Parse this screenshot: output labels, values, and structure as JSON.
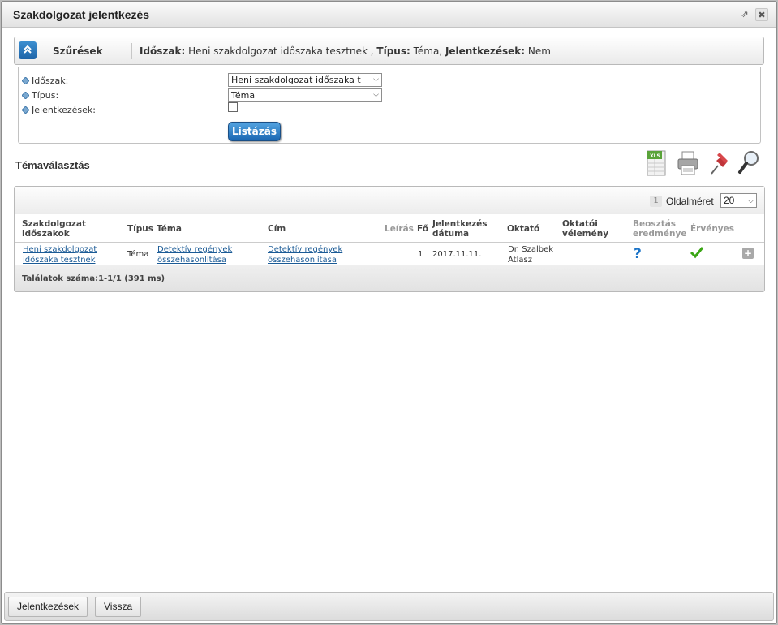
{
  "window": {
    "title": "Szakdolgozat jelentkezés",
    "popout_icon": "external-link-icon",
    "close_icon": "close-icon",
    "close_glyph": "✖",
    "popout_glyph": "⇗"
  },
  "filter": {
    "label": "Szűrések",
    "collapse_glyph": "⌃",
    "summary": {
      "idoszak_key": "Időszak:",
      "idoszak_val": " Heni szakdolgozat időszaka tesztnek , ",
      "tipus_key": "Típus:",
      "tipus_val": " Téma, ",
      "jel_key": "Jelentkezések:",
      "jel_val": " Nem"
    },
    "fields": {
      "idoszak_label": "Időszak:",
      "idoszak_value": "Heni szakdolgozat időszaka t",
      "tipus_label": "Típus:",
      "tipus_value": "Téma",
      "jelentkezesek_label": "Jelentkezések:",
      "jelentkezesek_checked": false
    },
    "list_button": "Listázás"
  },
  "section": {
    "title": "Témaválasztás",
    "tools": [
      "xls-export-icon",
      "print-icon",
      "pin-icon",
      "search-icon"
    ]
  },
  "grid": {
    "page_number": "1",
    "page_size_label": "Oldalméret",
    "page_size_value": "20",
    "columns": {
      "c1": "Szakdolgozat időszakok",
      "c2": "Típus",
      "c3": "Téma",
      "c4": "Cím",
      "c5": "Leírás",
      "c6": "Fő",
      "c7": "Jelentkezés dátuma",
      "c8": "Oktató",
      "c9": "Oktatói vélemény",
      "c10": "Beosztás eredménye",
      "c11": "Érvényes"
    },
    "rows": [
      {
        "idoszak": "Heni szakdolgozat időszaka tesztnek",
        "tipus": "Téma",
        "tema": "Detektív regények összehasonlítása",
        "cim": "Detektív regények összehasonlítása",
        "leiras": "",
        "fo": "1",
        "datum": "2017.11.11.",
        "oktato": "Dr. Szalbek Atlasz",
        "velemeny": "",
        "beosztas_icon": "question-icon",
        "ervenyes_icon": "checkmark-icon",
        "action_glyph": "+"
      }
    ],
    "found": "Találatok száma:1-1/1 (391 ms)"
  },
  "footer": {
    "jelentkezesek": "Jelentkezések",
    "vissza": "Vissza"
  },
  "colors": {
    "accent": "#1e64a8",
    "link": "#1b5b96",
    "check": "#3aa614",
    "question": "#1c74c8"
  }
}
